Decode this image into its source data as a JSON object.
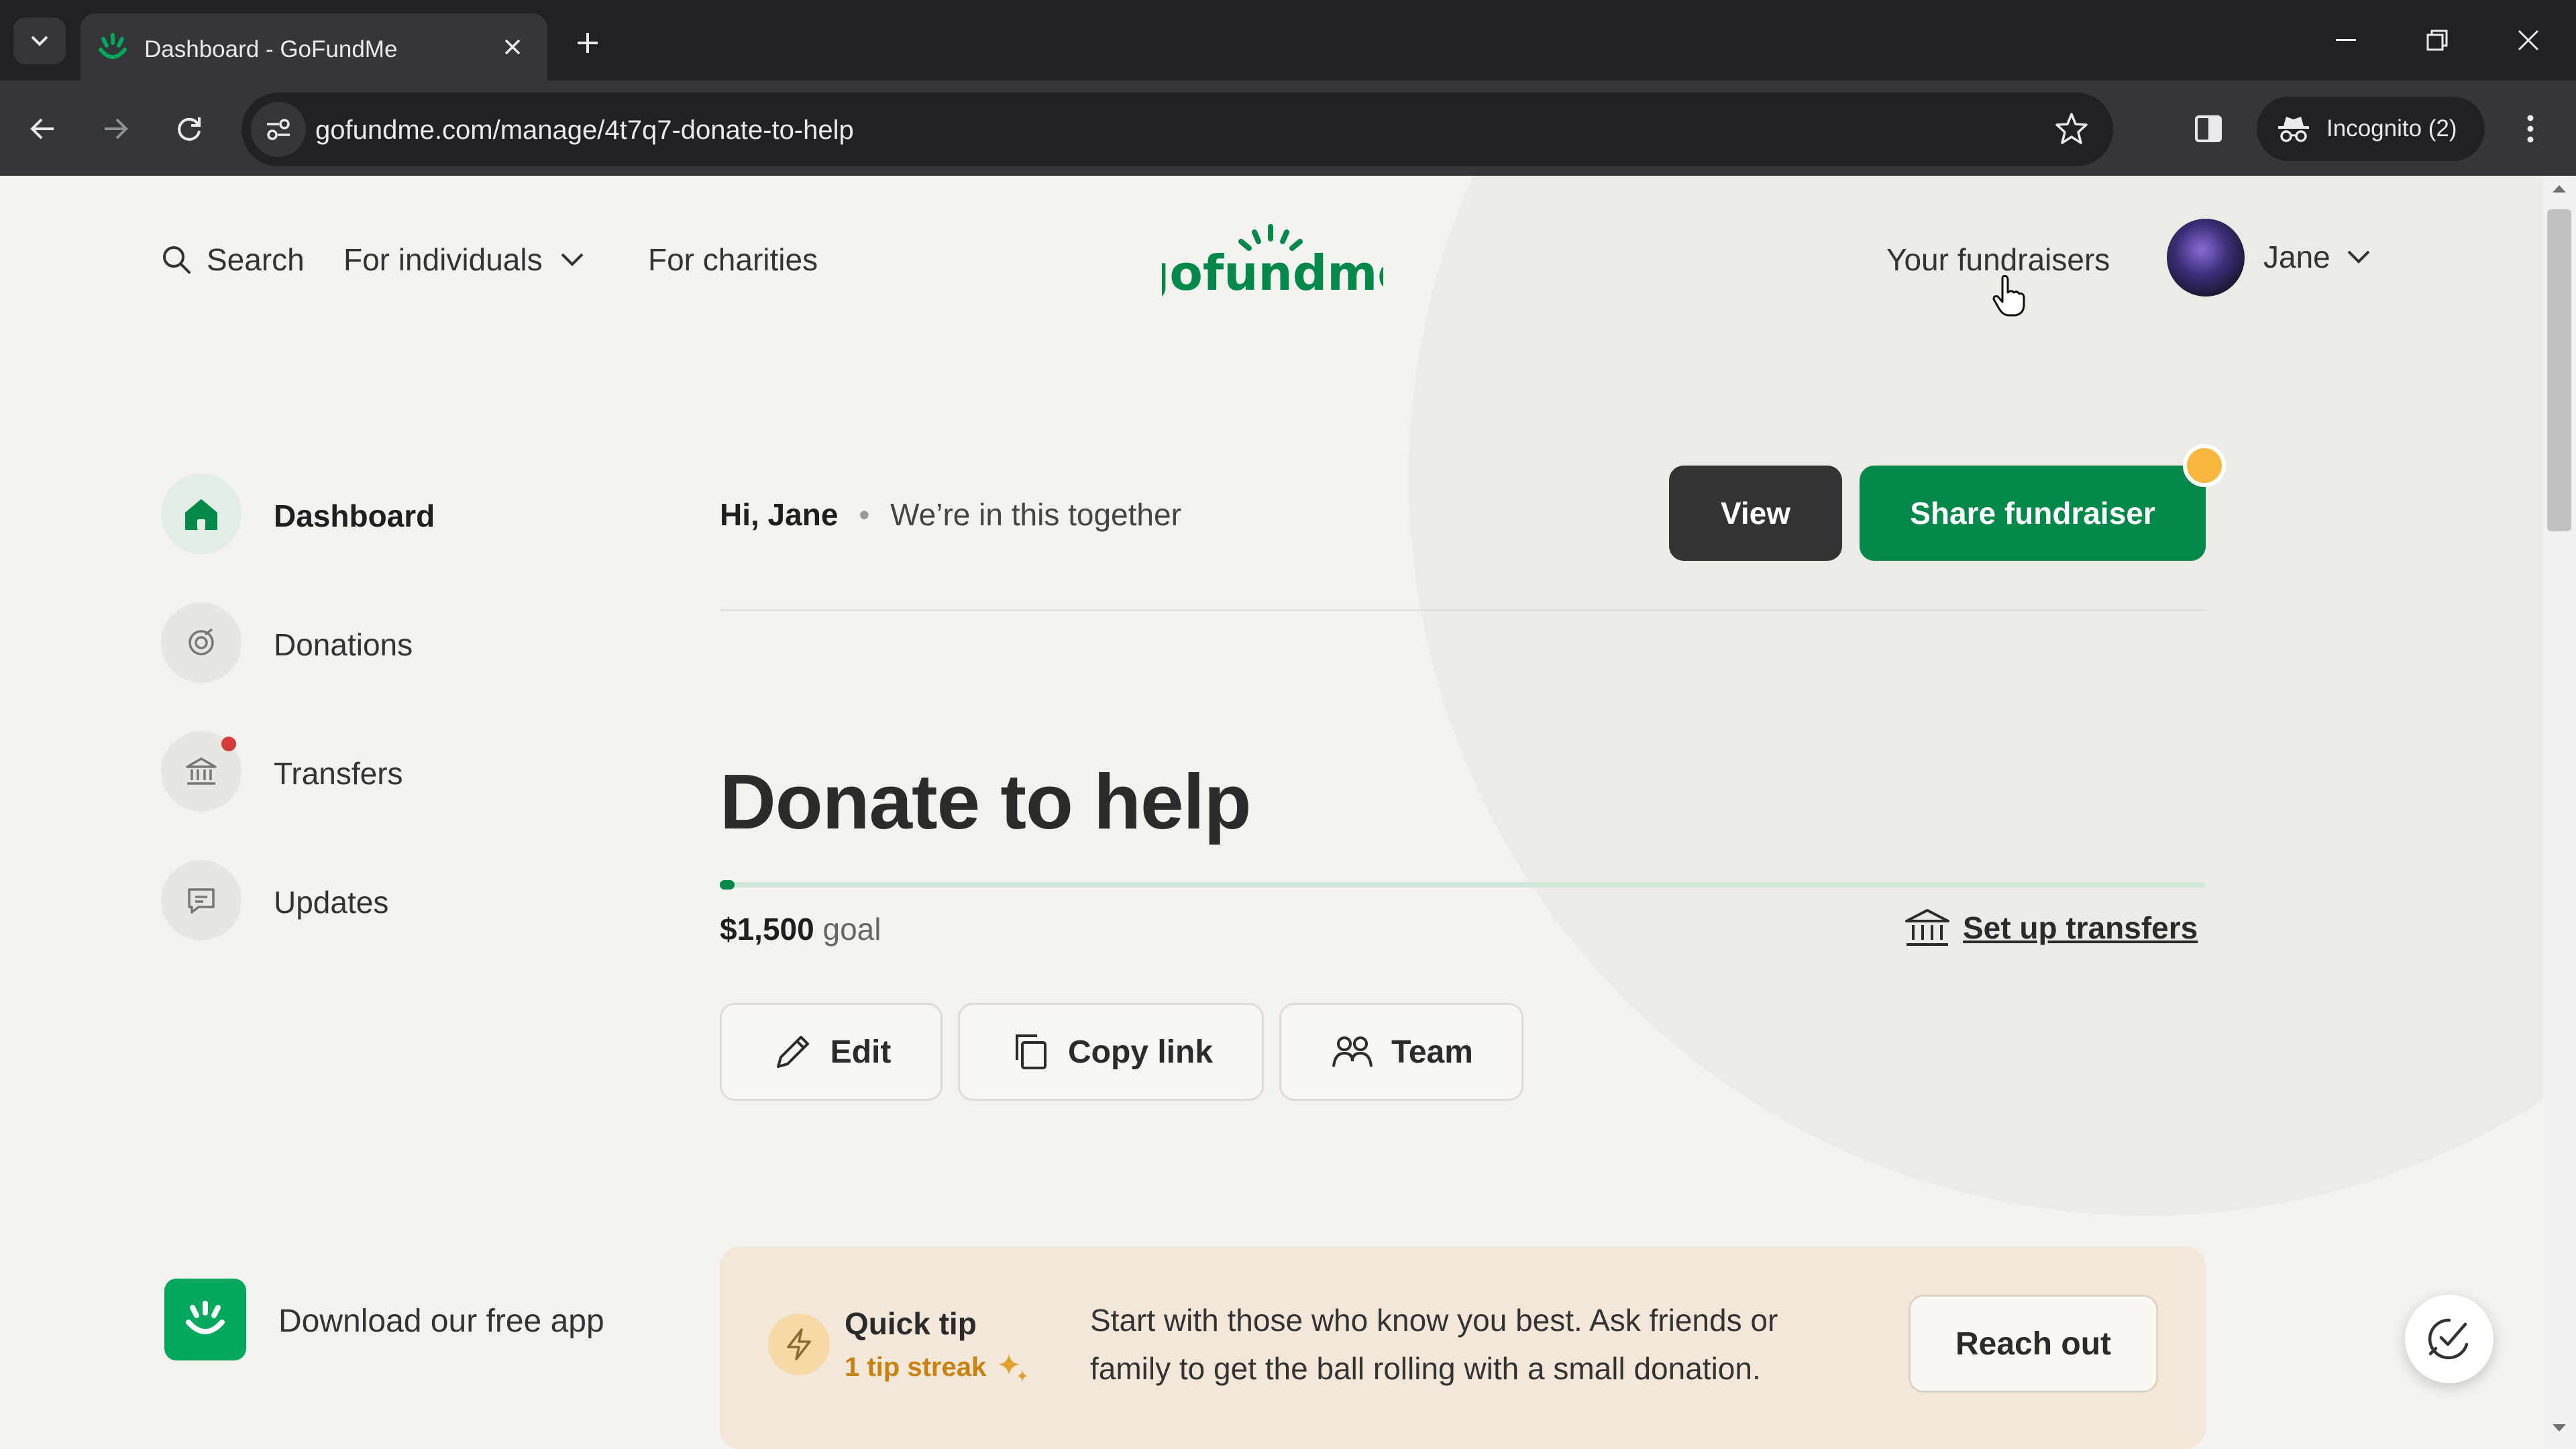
{
  "browser": {
    "tab_title": "Dashboard - GoFundMe",
    "url": "gofundme.com/manage/4t7q7-donate-to-help",
    "incognito_label": "Incognito (2)",
    "icons": [
      "tab-list-icon",
      "close-icon",
      "plus-icon",
      "minimize-icon",
      "restore-icon",
      "close-window-icon",
      "back-icon",
      "forward-icon",
      "reload-icon",
      "site-info-icon",
      "star-icon",
      "side-panel-icon",
      "incognito-icon",
      "kebab-menu-icon"
    ]
  },
  "header": {
    "search_label": "Search",
    "for_individuals_label": "For individuals",
    "for_charities_label": "For charities",
    "logo_text": "gofundme",
    "your_fundraisers_label": "Your fundraisers",
    "user_name": "Jane"
  },
  "sidebar": {
    "items": [
      {
        "label": "Dashboard",
        "icon": "home-icon",
        "active": true
      },
      {
        "label": "Donations",
        "icon": "donations-icon",
        "active": false
      },
      {
        "label": "Transfers",
        "icon": "bank-icon",
        "active": false,
        "has_notification": true
      },
      {
        "label": "Updates",
        "icon": "updates-icon",
        "active": false
      }
    ],
    "app_promo_label": "Download our free app"
  },
  "main": {
    "greeting_name": "Hi, Jane",
    "greeting_separator": "•",
    "greeting_message": "We’re in this together",
    "view_label": "View",
    "share_label": "Share fundraiser",
    "fundraiser_title": "Donate to help",
    "progress_fraction": 0.004,
    "goal_amount": "$1,500",
    "goal_suffix": "goal",
    "set_up_transfers_label": "Set up transfers",
    "actions": {
      "edit": "Edit",
      "copy_link": "Copy link",
      "team": "Team"
    }
  },
  "quick_tip": {
    "title": "Quick tip",
    "streak": "1 tip streak",
    "text": "Start with those who know you best. Ask friends or family to get the ball rolling with a small donation.",
    "button_label": "Reach out"
  },
  "colors": {
    "brand_green": "#02894a",
    "dark_button": "#333333",
    "notification_orange": "#f6b73c",
    "notification_red": "#d63b3b",
    "tip_background": "#f3e7da",
    "streak_orange": "#c98210"
  }
}
